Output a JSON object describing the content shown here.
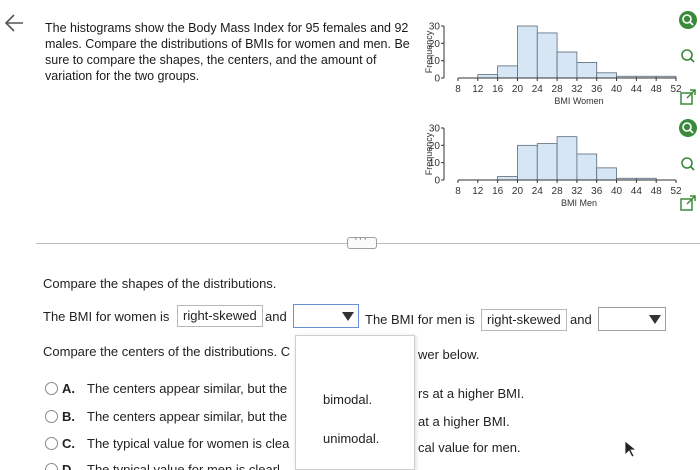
{
  "question": {
    "text": "The histograms show the Body Mass Index for 95 females and 92 males. Compare the distributions of BMIs for women and men. Be sure to compare the shapes, the centers, and the amount of variation for the two groups."
  },
  "icons": {
    "back": "back-arrow-icon",
    "side": [
      "zoom-in-icon",
      "zoom-out-icon",
      "external-link-icon",
      "zoom-in-icon",
      "zoom-out-icon",
      "external-link-icon"
    ]
  },
  "charts": {
    "women": {
      "ylabel": "Frequency",
      "xlabel": "BMI Women",
      "y_ticks": [
        "0",
        "10",
        "20",
        "30"
      ],
      "x_ticks": [
        "8",
        "12",
        "16",
        "20",
        "24",
        "28",
        "32",
        "36",
        "40",
        "44",
        "48",
        "52"
      ]
    },
    "men": {
      "ylabel": "Frequency",
      "xlabel": "BMI Men",
      "y_ticks": [
        "0",
        "10",
        "20",
        "30"
      ],
      "x_ticks": [
        "8",
        "12",
        "16",
        "20",
        "24",
        "28",
        "32",
        "36",
        "40",
        "44",
        "48",
        "52"
      ]
    }
  },
  "chart_data": [
    {
      "type": "bar",
      "title": "",
      "xlabel": "BMI Women",
      "ylabel": "Frequency",
      "bin_width": 4,
      "x_range": [
        8,
        52
      ],
      "ylim": [
        0,
        30
      ],
      "bins": [
        {
          "from": 12,
          "to": 16,
          "value": 2
        },
        {
          "from": 16,
          "to": 20,
          "value": 7
        },
        {
          "from": 20,
          "to": 24,
          "value": 30
        },
        {
          "from": 24,
          "to": 28,
          "value": 26
        },
        {
          "from": 28,
          "to": 32,
          "value": 15
        },
        {
          "from": 32,
          "to": 36,
          "value": 9
        },
        {
          "from": 36,
          "to": 40,
          "value": 3
        },
        {
          "from": 40,
          "to": 44,
          "value": 1
        },
        {
          "from": 44,
          "to": 48,
          "value": 1
        },
        {
          "from": 48,
          "to": 52,
          "value": 1
        }
      ]
    },
    {
      "type": "bar",
      "title": "",
      "xlabel": "BMI Men",
      "ylabel": "Frequency",
      "bin_width": 4,
      "x_range": [
        8,
        52
      ],
      "ylim": [
        0,
        30
      ],
      "bins": [
        {
          "from": 16,
          "to": 20,
          "value": 2
        },
        {
          "from": 20,
          "to": 24,
          "value": 20
        },
        {
          "from": 24,
          "to": 28,
          "value": 21
        },
        {
          "from": 28,
          "to": 32,
          "value": 25
        },
        {
          "from": 32,
          "to": 36,
          "value": 15
        },
        {
          "from": 36,
          "to": 40,
          "value": 7
        },
        {
          "from": 40,
          "to": 44,
          "value": 1
        },
        {
          "from": 44,
          "to": 48,
          "value": 1
        }
      ]
    }
  ],
  "section": {
    "shapes_prompt": "Compare the shapes of the distributions.",
    "women_prefix": "The BMI for women is",
    "women_answer": "right-skewed",
    "and1": "and",
    "men_prefix": "The BMI for men is",
    "men_answer": "right-skewed",
    "and2": "and",
    "centers_prompt": "Compare the centers of the distributions. C",
    "centers_tail": "wer below."
  },
  "options": [
    {
      "letter": "A.",
      "text_left": "The centers appear similar, but the",
      "text_right": "rs at a higher BMI."
    },
    {
      "letter": "B.",
      "text_left": "The centers appear similar, but the",
      "text_right": "at a higher BMI."
    },
    {
      "letter": "C.",
      "text_left": "The typical value for women is clea",
      "text_right": "cal value for men."
    },
    {
      "letter": "D.",
      "text_left": "The typical value for men is clearl",
      "text_right": ""
    }
  ],
  "dropdown": {
    "items": [
      "bimodal.",
      "unimodal."
    ]
  }
}
